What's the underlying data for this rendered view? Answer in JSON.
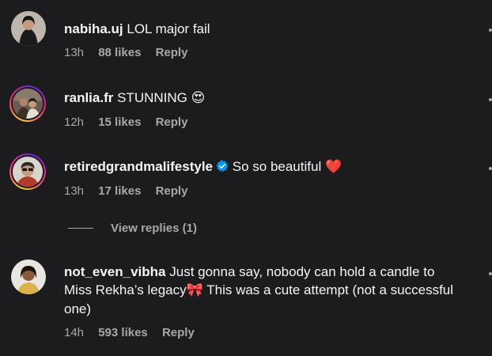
{
  "comments": [
    {
      "username": "nabiha.uj",
      "text": "LOL major fail",
      "time": "13h",
      "likes": "88 likes",
      "reply": "Reply",
      "verified": false,
      "story_ring": false
    },
    {
      "username": "ranlia.fr",
      "text": "STUNNING",
      "emoji": "😍",
      "time": "12h",
      "likes": "15 likes",
      "reply": "Reply",
      "verified": false,
      "story_ring": true
    },
    {
      "username": "retiredgrandmalifestyle",
      "text": "So so beautiful",
      "emoji": "❤️",
      "time": "13h",
      "likes": "17 likes",
      "reply": "Reply",
      "verified": true,
      "story_ring": true
    },
    {
      "username": "not_even_vibha",
      "text": "Just gonna say, nobody can hold a candle to Miss Rekha’s legacy",
      "emoji": "🎀",
      "text_after": "This was a cute attempt (not a successful one)",
      "time": "14h",
      "likes": "593 likes",
      "reply": "Reply",
      "verified": false,
      "story_ring": false
    }
  ],
  "view_replies": "View replies (1)",
  "colors": {
    "background": "#1c1c1e",
    "primary_text": "#f5f5f5",
    "secondary_text": "#a8a8a8",
    "verified_blue": "#0095f6"
  }
}
